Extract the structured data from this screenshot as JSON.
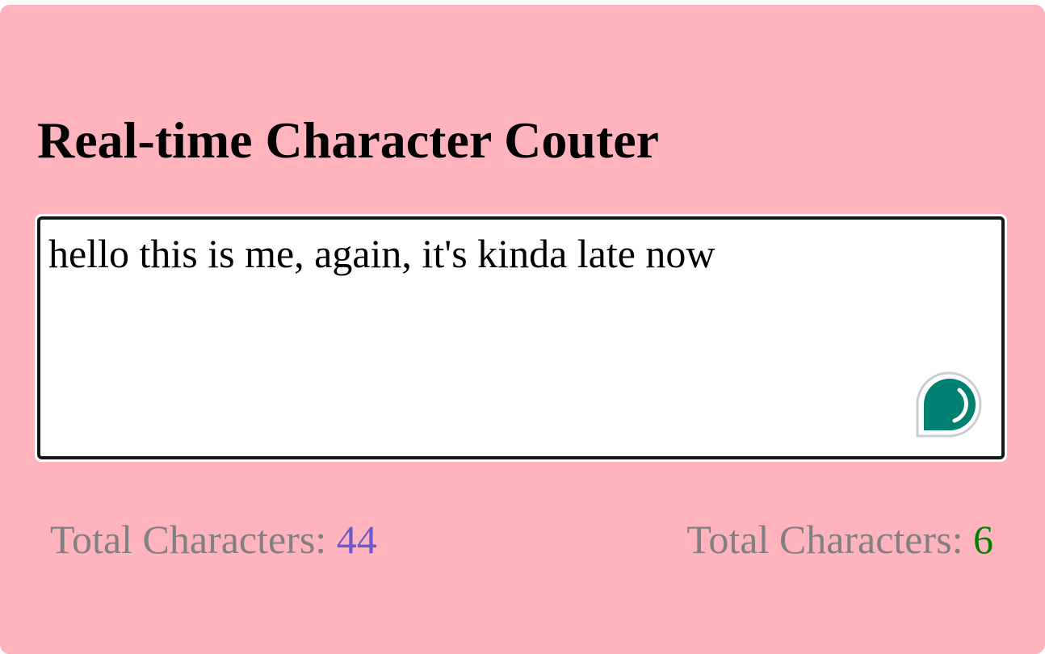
{
  "page": {
    "title": "Real-time Character Couter"
  },
  "editor": {
    "value": "hello this is me, again, it's kinda late now"
  },
  "stats": {
    "left_label": "Total Characters: ",
    "left_value": "44",
    "right_label": "Total Characters: ",
    "right_value": "6"
  },
  "colors": {
    "background": "#ffb4bd",
    "label": "#808080",
    "left_value": "#6a5acd",
    "right_value": "#008000",
    "assistant_button": "#008070"
  },
  "icons": {
    "assistant": "chat-assistant-icon"
  }
}
